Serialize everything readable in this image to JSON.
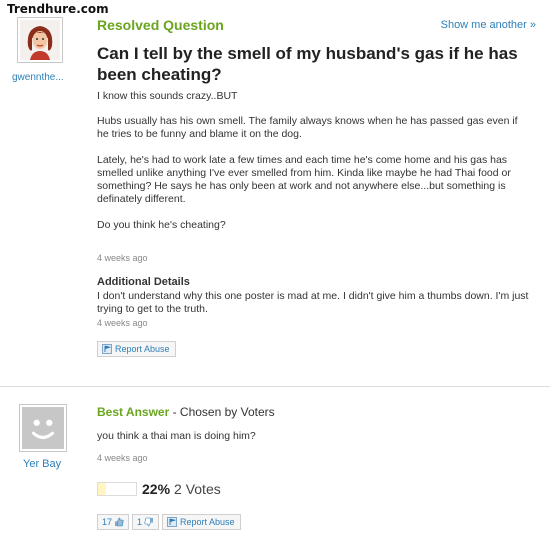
{
  "watermark": "Trendhure.com",
  "question": {
    "status_label": "Resolved Question",
    "show_another": "Show me another »",
    "asker_name": "gwennthe...",
    "title": "Can I tell by the smell of my husband's gas if he has been cheating?",
    "body": [
      "I know this sounds crazy..BUT",
      "Hubs usually has his own smell. The family always knows when he has passed gas even if he tries to be funny and blame it on the dog.",
      "Lately, he's had to work late a few times and each time he's come home and his gas has smelled unlike anything I've ever smelled from him. Kinda like maybe he had Thai food or something? He says he has only been at work and not anywhere else...but something is definately different.",
      "Do you think he's cheating?"
    ],
    "asked_ago": "4 weeks ago",
    "additional_details_heading": "Additional Details",
    "additional_details": "I don't understand why this one poster is mad at me. I didn't give him a thumbs down. I'm just trying to get to the truth.",
    "details_ago": "4 weeks ago",
    "report_abuse": "Report Abuse"
  },
  "answer": {
    "answerer_name": "Yer Bay",
    "best_answer_label": "Best Answer",
    "chosen_by": " - Chosen by Voters",
    "text": "you think a thai man is doing him?",
    "answered_ago": "4 weeks ago",
    "rating_percent": "22%",
    "rating_fraction": 0.22,
    "votes": "2 Votes",
    "thumbs_up_count": "17",
    "thumbs_down_count": "1",
    "report_abuse": "Report Abuse"
  },
  "icons": {
    "flag": "flag-icon",
    "thumbs_up": "thumbs-up-icon",
    "thumbs_down": "thumbs-down-icon",
    "asker_avatar": "avatar-woman-icon",
    "answerer_avatar": "avatar-default-smiley-icon"
  },
  "colors": {
    "link_blue": "#2e7fb8",
    "resolved_green": "#6aa51e",
    "rating_fill": "#fff6c4"
  }
}
